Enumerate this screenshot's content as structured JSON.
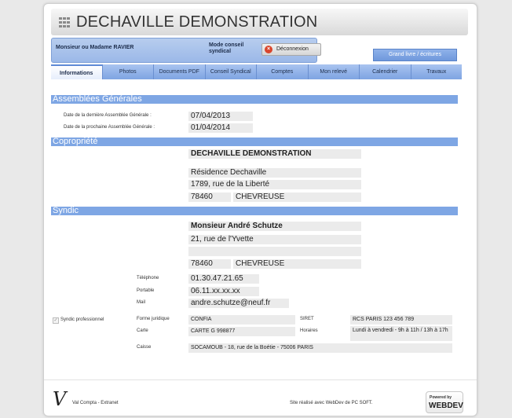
{
  "header": {
    "title": "DECHAVILLE DEMONSTRATION"
  },
  "userbar": {
    "user": "Monsieur ou Madame RAVIER",
    "mode": "Mode conseil syndical",
    "logout_label": "Déconnexion"
  },
  "ledger_button": "Grand livre / écritures",
  "tabs": [
    {
      "label": "Informations",
      "active": true
    },
    {
      "label": "Photos"
    },
    {
      "label": "Documents PDF"
    },
    {
      "label": "Conseil Syndical"
    },
    {
      "label": "Comptes"
    },
    {
      "label": "Mon relevé"
    },
    {
      "label": "Calendrier"
    },
    {
      "label": "Travaux"
    }
  ],
  "assemblees": {
    "heading": "Assemblées Générales",
    "last_label": "Date de la dernière Assemblée Générale :",
    "last_value": "07/04/2013",
    "next_label": "Date de la prochaine Assemblée Générale :",
    "next_value": "01/04/2014"
  },
  "copropriete": {
    "heading": "Copropriété",
    "name": "DECHAVILLE DEMONSTRATION",
    "line1": "Résidence Dechaville",
    "line2": "1789, rue de la Liberté",
    "postal": "78460",
    "city": "CHEVREUSE"
  },
  "syndic": {
    "heading": "Syndic",
    "name": "Monsieur André Schutze",
    "line1": "21, rue de l'Yvette",
    "line2": "",
    "postal": "78460",
    "city": "CHEVREUSE",
    "phone_label": "Téléphone",
    "phone": "01.30.47.21.65",
    "mobile_label": "Portable",
    "mobile": "06.11.xx.xx.xx",
    "mail_label": "Mail",
    "mail": "andre.schutze@neuf.fr",
    "pro_label": "Syndic professionnel",
    "forme_label": "Forme juridique",
    "forme": "CONFIA",
    "siret_label": "SIRET",
    "siret": "RCS PARIS 123 456 789",
    "carte_label": "Carte",
    "carte": "CARTE G 998877",
    "horaires_label": "Horaires",
    "horaires": "Lundi à vendredi - 9h à 11h / 13h à 17h",
    "caisse_label": "Caisse",
    "caisse": "SOCAMOUB - 18, rue de la Boétie - 75006 PARIS"
  },
  "footer": {
    "logo": "V",
    "app": "Val Compta - Extranet",
    "credit": "Site réalisé avec WebDev de PC SOFT.",
    "badge_top": "Powered by",
    "badge_main": "WEBDEV"
  }
}
